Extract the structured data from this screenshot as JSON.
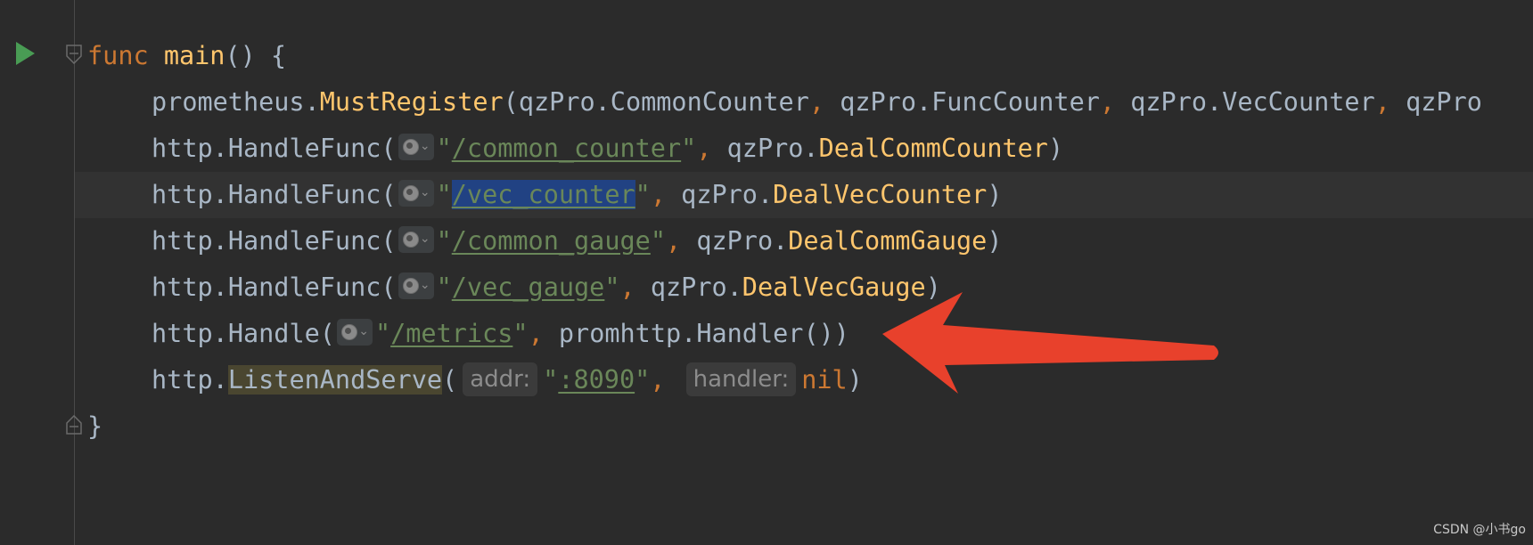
{
  "editor": {
    "line1": {
      "kw": "func",
      "name": "main",
      "tail": "() {"
    },
    "line2": {
      "pkg": "prometheus",
      "dot": ".",
      "fn": "MustRegister",
      "open": "(",
      "a1": "qzPro.CommonCounter",
      "c1": ", ",
      "a2": "qzPro.FuncCounter",
      "c2": ", ",
      "a3": "qzPro.VecCounter",
      "c3": ", ",
      "a4": "qzPro"
    },
    "line3": {
      "pkg": "http",
      "dot": ".",
      "fn": "HandleFunc",
      "open": "(",
      "q1": "\"",
      "url": "/common_counter",
      "q2": "\"",
      "comma": ", ",
      "recv": "qzPro.",
      "handler": "DealCommCounter",
      "close": ")"
    },
    "line4": {
      "pkg": "http",
      "dot": ".",
      "fn": "HandleFunc",
      "open": "(",
      "q1": "\"",
      "url": "/vec_counter",
      "q2": "\"",
      "comma": ", ",
      "recv": "qzPro.",
      "handler": "DealVecCounter",
      "close": ")"
    },
    "line5": {
      "pkg": "http",
      "dot": ".",
      "fn": "HandleFunc",
      "open": "(",
      "q1": "\"",
      "url": "/common_gauge",
      "q2": "\"",
      "comma": ", ",
      "recv": "qzPro.",
      "handler": "DealCommGauge",
      "close": ")"
    },
    "line6": {
      "pkg": "http",
      "dot": ".",
      "fn": "HandleFunc",
      "open": "(",
      "q1": "\"",
      "url": "/vec_gauge",
      "q2": "\"",
      "comma": ", ",
      "recv": "qzPro.",
      "handler": "DealVecGauge",
      "close": ")"
    },
    "line7": {
      "pkg": "http",
      "dot": ".",
      "fn": "Handle",
      "open": "(",
      "q1": "\"",
      "url": "/metrics",
      "q2": "\"",
      "comma": ", ",
      "recv": "promhttp.",
      "handler": "Handler",
      "close": "())"
    },
    "line8": {
      "pkg": "http",
      "dot": ".",
      "fn": "ListenAndServe",
      "open": "(",
      "hint1": "addr:",
      "q1": "\"",
      "url": ":8090",
      "q2": "\"",
      "comma": ",",
      "hint2": "handler:",
      "nil": "nil",
      "close": ")"
    },
    "line9": {
      "brace": "}"
    }
  },
  "icons": {
    "run": "run-play-icon",
    "fold_open": "fold-collapse-icon",
    "fold_close": "fold-end-icon",
    "globe": "globe-endpoint-icon"
  },
  "colors": {
    "background": "#2b2b2b",
    "keyword": "#cc7832",
    "function": "#ffc66d",
    "string": "#6a8759",
    "default": "#a9b7c6",
    "selection": "#214283",
    "arrow": "#e8412c"
  },
  "watermark": "CSDN @小书go"
}
